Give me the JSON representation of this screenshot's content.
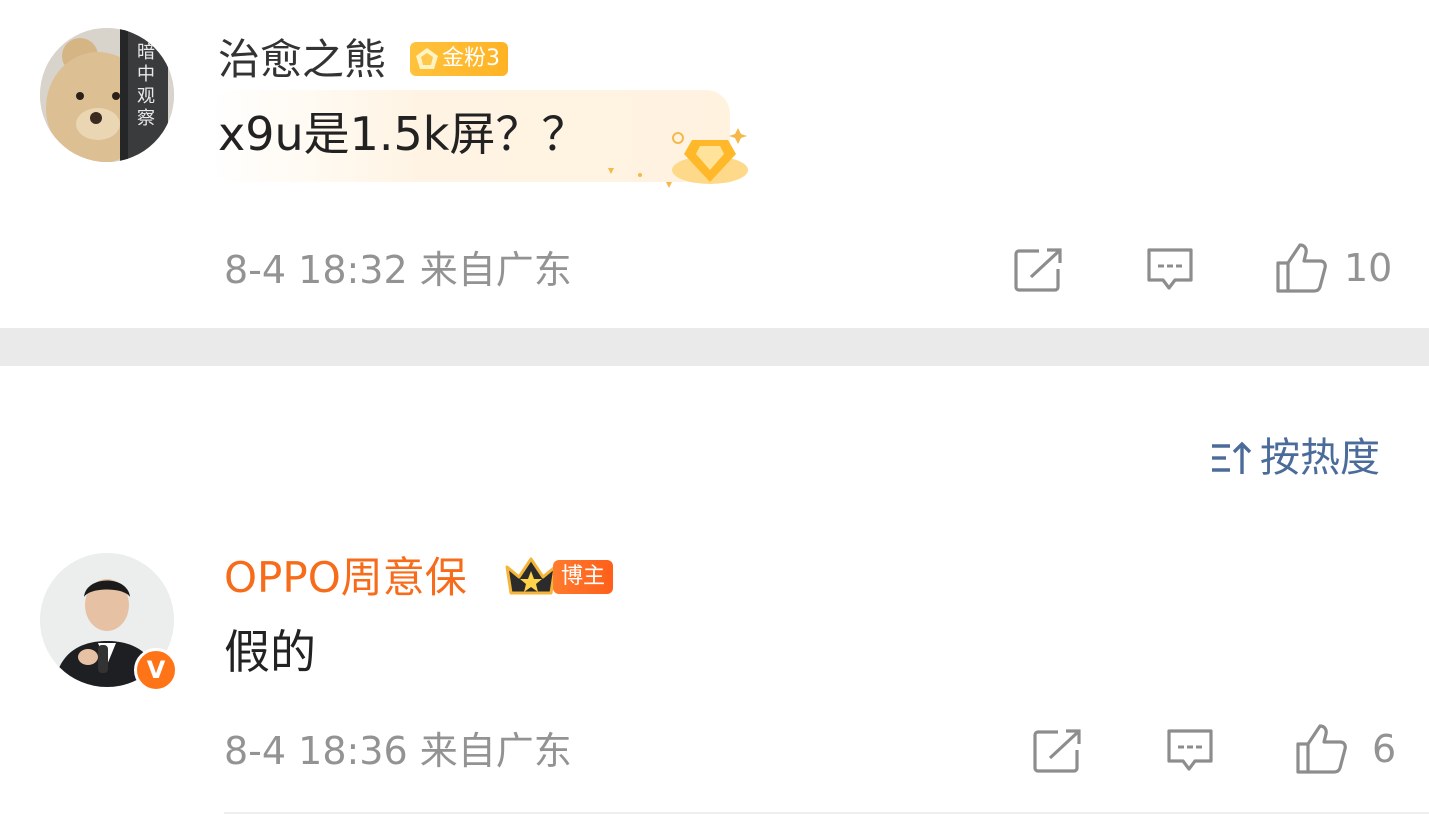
{
  "comments": [
    {
      "user": "治愈之熊",
      "badge": "金粉3",
      "text": "x9u是1.5k屏？？",
      "meta": "8-4 18:32 来自广东",
      "likes": "10",
      "avatar_text": "暗中观察"
    },
    {
      "user": "OPPO周意保",
      "badge": "博主",
      "text": "假的",
      "meta": "8-4 18:36 来自广东",
      "likes": "6",
      "verified": "V"
    }
  ],
  "sort": {
    "label": "按热度"
  },
  "colors": {
    "accent_orange": "#f76c1b",
    "meta_gray": "#939393",
    "link_blue": "#4b6c9b",
    "divider": "#eaeaea"
  },
  "icons": [
    "share-icon",
    "comment-icon",
    "like-icon",
    "sort-icon",
    "crown-icon",
    "fan-badge-icon",
    "verified-icon"
  ]
}
